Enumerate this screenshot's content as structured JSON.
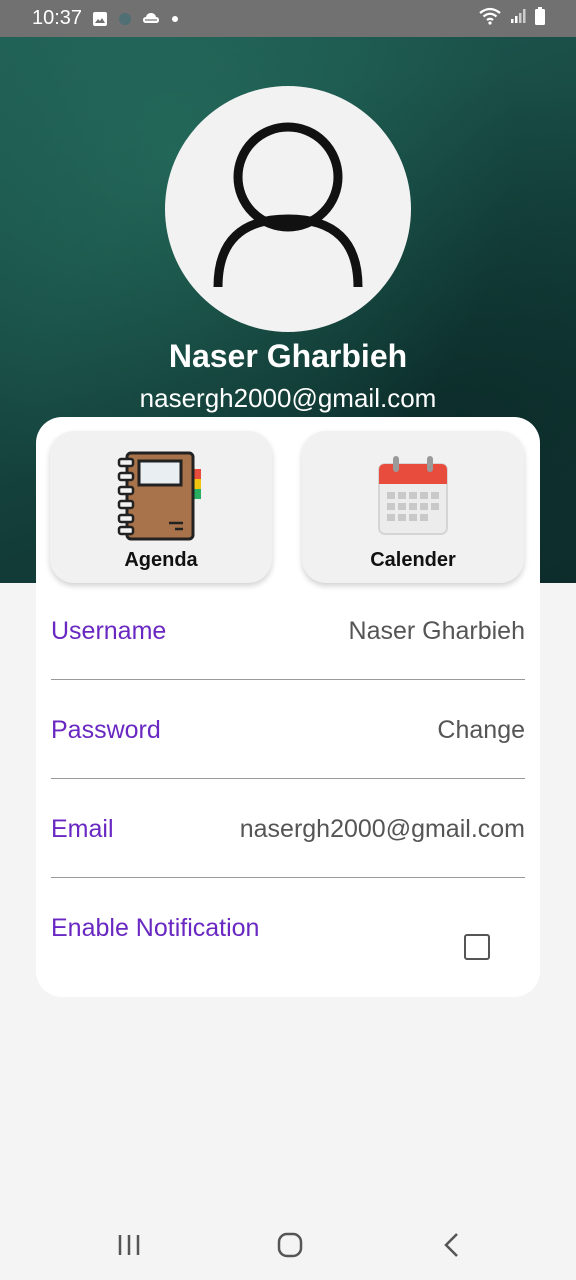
{
  "status_bar": {
    "time": "10:37",
    "icons_left": [
      "gallery-icon",
      "app-icon",
      "cloud-icon",
      "dot-icon"
    ],
    "icons_right": [
      "wifi-icon",
      "signal-icon",
      "battery-icon"
    ]
  },
  "profile": {
    "name": "Naser Gharbieh",
    "email": "nasergh2000@gmail.com"
  },
  "tiles": {
    "agenda_label": "Agenda",
    "calendar_label": "Calender"
  },
  "settings": {
    "username_label": "Username",
    "username_value": "Naser Gharbieh",
    "password_label": "Password",
    "password_value": "Change",
    "email_label": "Email",
    "email_value": "nasergh2000@gmail.com",
    "notification_label": "Enable Notification",
    "notification_checked": false
  },
  "nav": [
    "recents-icon",
    "home-icon",
    "back-icon"
  ],
  "colors": {
    "accent": "#6a28c2",
    "header_dark": "#134039",
    "status_bar": "#717171"
  }
}
